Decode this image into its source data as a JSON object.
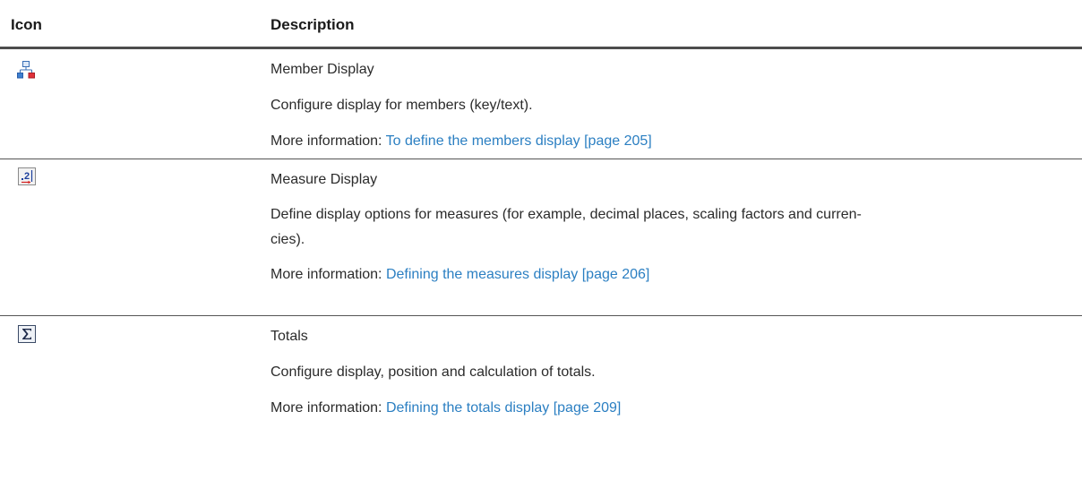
{
  "header": {
    "icon_col": "Icon",
    "desc_col": "Description"
  },
  "rows": [
    {
      "icon": "member-hierarchy-icon",
      "title": "Member Display",
      "description": "Configure display for members (key/text).",
      "more_prefix": "More information: ",
      "link_text": "To define the members display [page 205]"
    },
    {
      "icon": "decimal-places-icon",
      "title": "Measure Display",
      "description": "Define display options for measures (for example, decimal places, scaling factors and curren-\ncies).",
      "more_prefix": "More information: ",
      "link_text": "Defining the measures display [page 206]"
    },
    {
      "icon": "sigma-icon",
      "title": "Totals",
      "description": "Configure display, position and calculation of totals.",
      "more_prefix": "More information: ",
      "link_text": "Defining the totals display [page 209]"
    }
  ],
  "colors": {
    "link": "#2b7fc2",
    "header_rule": "#4d4d4d",
    "row_rule": "#555555"
  }
}
